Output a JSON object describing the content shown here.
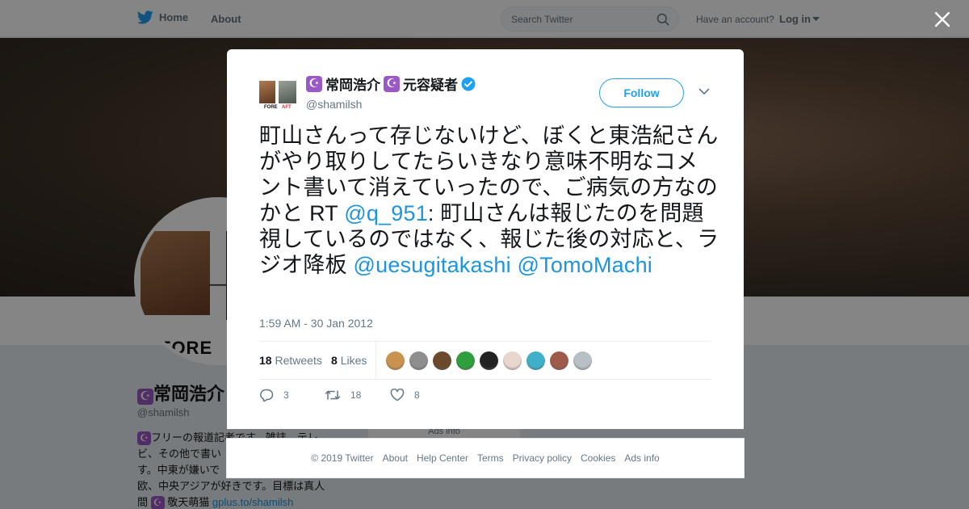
{
  "nav": {
    "home_label": "Home",
    "about_label": "About",
    "search_placeholder": "Search Twitter",
    "have_account": "Have an account?",
    "login_label": "Log in"
  },
  "background_profile": {
    "avatar_text": "FORE",
    "name": "常岡浩介",
    "handle": "@shamilsh",
    "bio_lines": [
      "フリーの報道記者です。雑誌、テレ",
      "ビ、その他で書い",
      "す。中東が嫌いで",
      "欧、中央アジアが好きです。目標は真人",
      "間"
    ],
    "bio_tail": "敬天萌猫",
    "bio_link": "gplus.to/shamilsh",
    "ads_info": "Ads info"
  },
  "tweet": {
    "author_name_part1": "常岡浩介",
    "author_name_part2": "元容疑者",
    "author_handle": "@shamilsh",
    "avatar_label_left": "FORE",
    "avatar_label_right": "AFT",
    "follow_label": "Follow",
    "text_main": "町山さんって存じないけど、ぼくと東浩紀さんがやり取りしてたらいきなり意味不明なコメント書いて消えていったので、ご病気の方なのかと RT ",
    "mention_1": "@q_951",
    "text_after_mention": ": 町山さんは報じたのを問題視しているのではなく、報じた後の対応と、ラジオ降板 ",
    "mention_2": "@uesugitakashi",
    "mention_3": "@TomoMachi",
    "timestamp": "1:59 AM - 30 Jan 2012",
    "retweet_count": "18",
    "retweet_label": "Retweets",
    "like_count": "8",
    "like_label": "Likes",
    "reply_action_count": "3",
    "retweet_action_count": "18",
    "like_action_count": "8",
    "liker_colors": [
      "#c9934f",
      "#8e8e8e",
      "#6b4a2c",
      "#2e9e3e",
      "#222222",
      "#e8d6cf",
      "#3fb0c9",
      "#a05a4a",
      "#b8c0c6"
    ]
  },
  "footer": {
    "items": [
      "© 2019 Twitter",
      "About",
      "Help Center",
      "Terms",
      "Privacy policy",
      "Cookies",
      "Ads info"
    ]
  },
  "colors": {
    "accent": "#1da1f2",
    "link": "#1b95e0",
    "verified": "#1da1f2",
    "moon_badge": "#9b59c6"
  }
}
